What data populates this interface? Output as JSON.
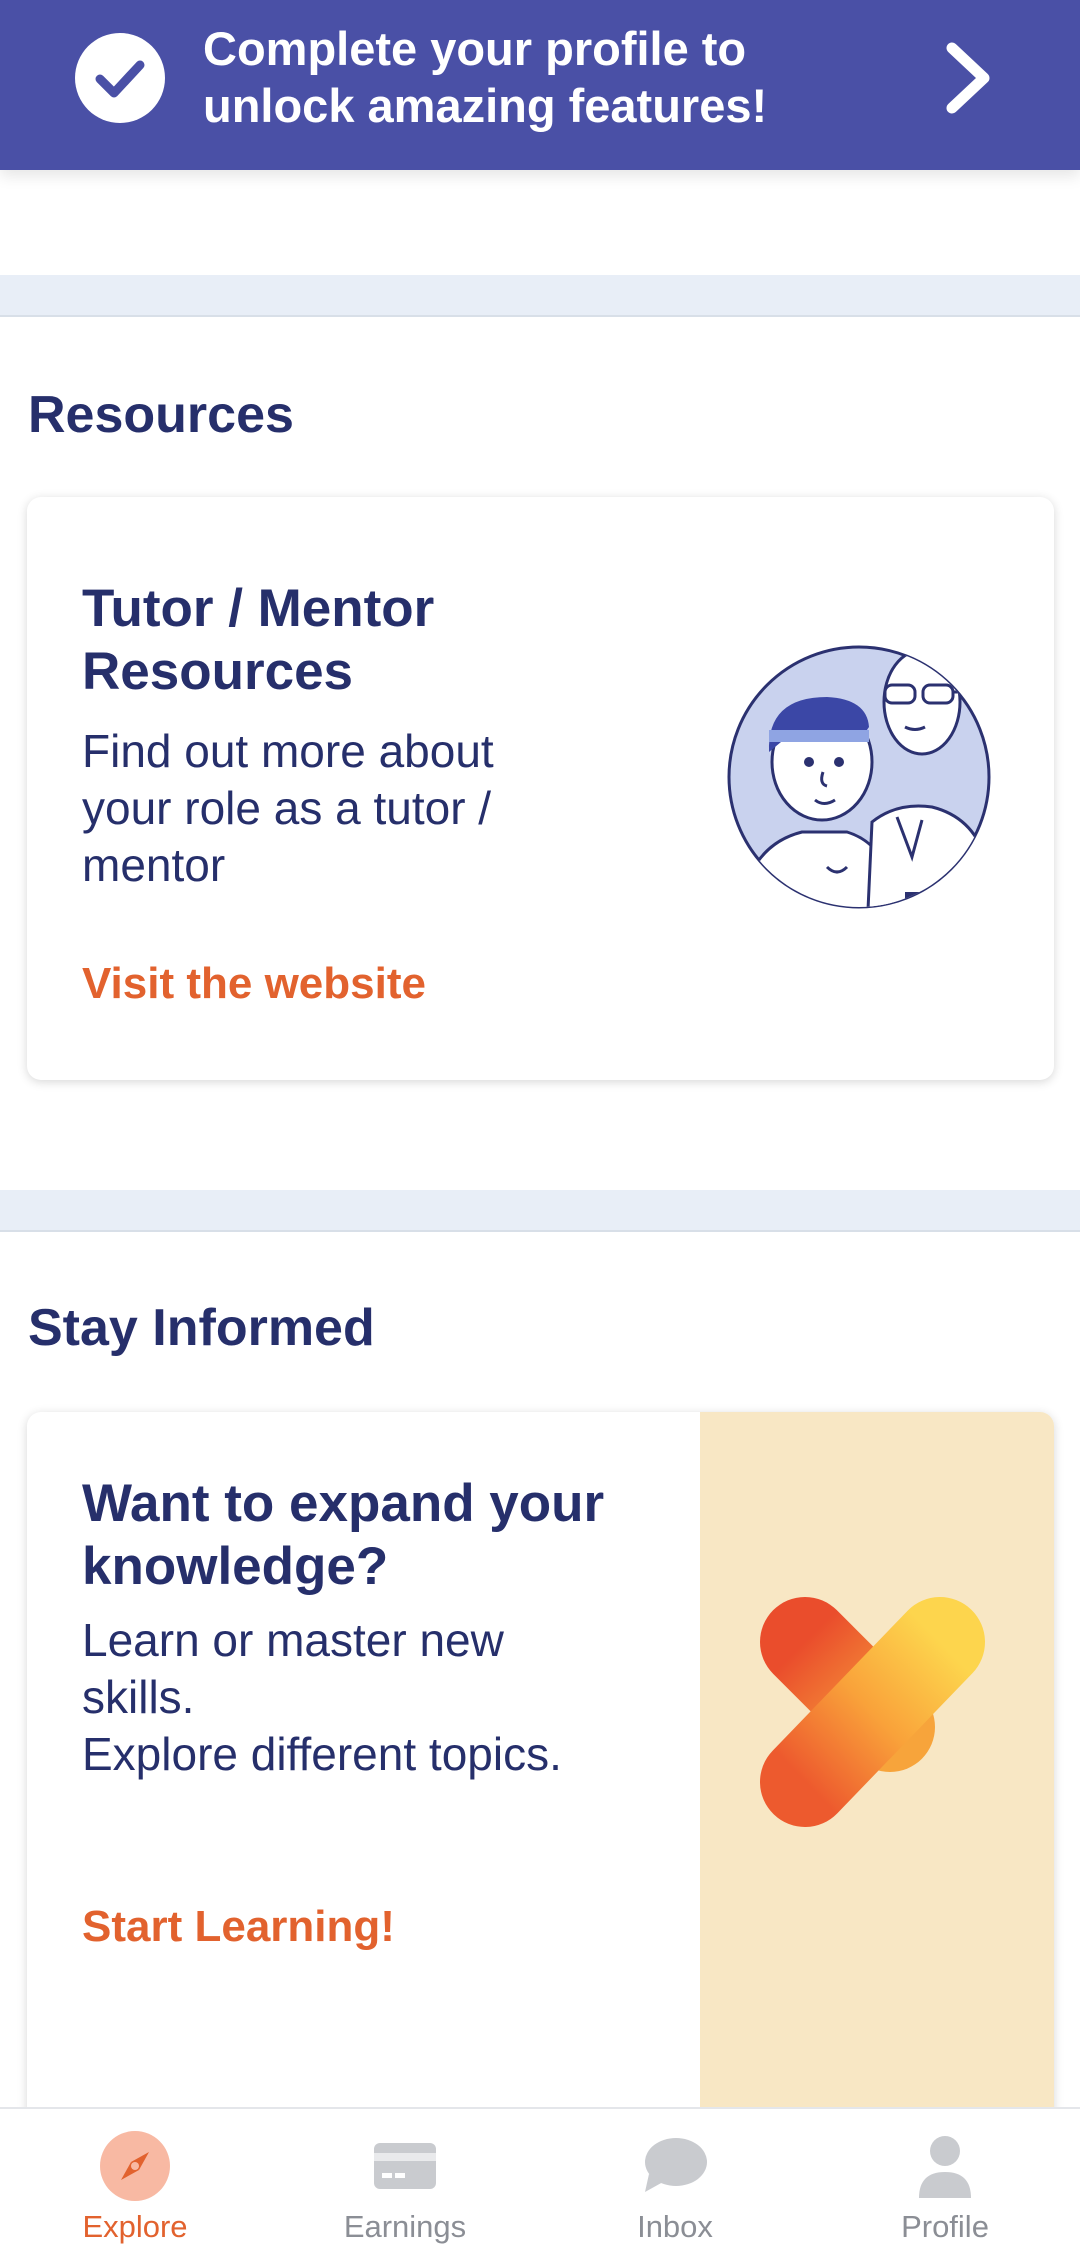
{
  "banner": {
    "text": "Complete your profile to unlock amazing features!",
    "bg_color": "#4a50a6"
  },
  "resources": {
    "section_title": "Resources",
    "card": {
      "title": "Tutor / Mentor Resources",
      "description": "Find out more about your role as a tutor / mentor",
      "link_label": "Visit the website"
    }
  },
  "stay_informed": {
    "section_title": "Stay Informed",
    "card": {
      "title": "Want to expand your knowledge?",
      "line1": "Learn or master new skills.",
      "line2": "Explore different topics.",
      "link_label": "Start Learning!"
    }
  },
  "nav": {
    "items": [
      {
        "label": "Explore",
        "icon": "compass-icon",
        "active": true
      },
      {
        "label": "Earnings",
        "icon": "card-icon",
        "active": false
      },
      {
        "label": "Inbox",
        "icon": "chat-bubble-icon",
        "active": false
      },
      {
        "label": "Profile",
        "icon": "person-icon",
        "active": false
      }
    ]
  },
  "colors": {
    "primary": "#4a50a6",
    "accent": "#e2622e",
    "text_dark": "#262f6b",
    "separator": "#e8eef7"
  }
}
